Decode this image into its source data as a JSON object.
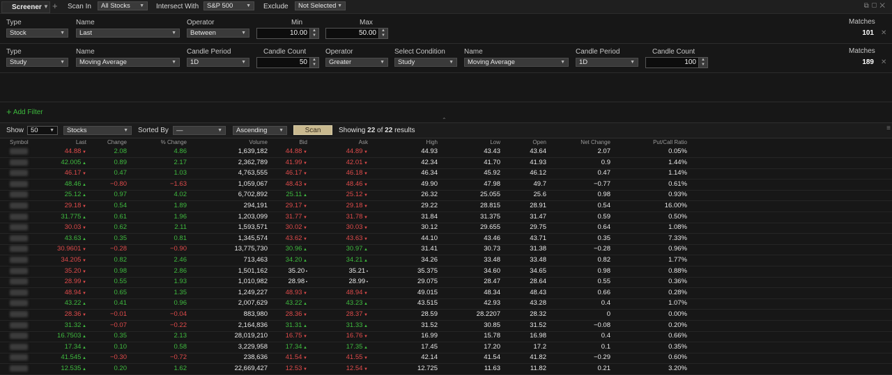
{
  "toolbar": {
    "tab_label": "Screener",
    "scan_in_label": "Scan In",
    "scan_in_value": "All Stocks",
    "intersect_label": "Intersect With",
    "intersect_value": "S&P 500",
    "exclude_label": "Exclude",
    "exclude_value": "Not Selected"
  },
  "filter1": {
    "type_label": "Type",
    "type_value": "Stock",
    "name_label": "Name",
    "name_value": "Last",
    "operator_label": "Operator",
    "operator_value": "Between",
    "min_label": "Min",
    "min_value": "10.00",
    "max_label": "Max",
    "max_value": "50.00",
    "matches_label": "Matches",
    "matches_value": "101"
  },
  "filter2": {
    "type_label": "Type",
    "type_value": "Study",
    "name_label": "Name",
    "name_value": "Moving Average",
    "candle_period_label": "Candle Period",
    "candle_period_value": "1D",
    "candle_count_label": "Candle Count",
    "candle_count_value": "50",
    "operator_label": "Operator",
    "operator_value": "Greater",
    "select_condition_label": "Select Condition",
    "select_condition_value": "Study",
    "name2_label": "Name",
    "name2_value": "Moving Average",
    "candle_period2_label": "Candle Period",
    "candle_period2_value": "1D",
    "candle_count2_label": "Candle Count",
    "candle_count2_value": "100",
    "matches_label": "Matches",
    "matches_value": "189"
  },
  "add_filter_label": "Add Filter",
  "controls": {
    "show_label": "Show",
    "show_value": "50",
    "list_value": "Stocks",
    "sorted_by_label": "Sorted By",
    "sorted_by_value": "—",
    "order_value": "Ascending",
    "scan_label": "Scan",
    "showing_prefix": "Showing",
    "showing_count": "22",
    "showing_of": "of",
    "showing_total": "22",
    "showing_suffix": "results"
  },
  "columns": [
    "Symbol",
    "Last",
    "Change",
    "% Change",
    "Volume",
    "Bid",
    "Ask",
    "High",
    "Low",
    "Open",
    "Net Change",
    "Put/Call Ratio"
  ],
  "rows": [
    {
      "dir": "dn",
      "last": "44.88",
      "change": "2.08",
      "pct": "4.86",
      "volume": "1,639,182",
      "bid": "44.88",
      "bd": "dn",
      "ask": "44.89",
      "ad": "dn",
      "high": "44.93",
      "low": "43.43",
      "open": "43.64",
      "net": "2.07",
      "pc": "0.05%"
    },
    {
      "dir": "up",
      "last": "42.005",
      "change": "0.89",
      "pct": "2.17",
      "volume": "2,362,789",
      "bid": "41.99",
      "bd": "dn",
      "ask": "42.01",
      "ad": "dn",
      "high": "42.34",
      "low": "41.70",
      "open": "41.93",
      "net": "0.9",
      "pc": "1.44%"
    },
    {
      "dir": "dn",
      "last": "46.17",
      "change": "0.47",
      "pct": "1.03",
      "volume": "4,763,555",
      "bid": "46.17",
      "bd": "dn",
      "ask": "46.18",
      "ad": "dn",
      "high": "46.34",
      "low": "45.92",
      "open": "46.12",
      "net": "0.47",
      "pc": "1.14%"
    },
    {
      "dir": "up",
      "last": "48.46",
      "change": "−0.80",
      "pct": "−1.63",
      "volume": "1,059,067",
      "bid": "48.43",
      "bd": "dn",
      "ask": "48.46",
      "ad": "dn",
      "high": "49.90",
      "low": "47.98",
      "open": "49.7",
      "net": "−0.77",
      "pc": "0.61%"
    },
    {
      "dir": "up",
      "last": "25.12",
      "change": "0.97",
      "pct": "4.02",
      "volume": "6,702,892",
      "bid": "25.11",
      "bd": "up",
      "ask": "25.12",
      "ad": "dn",
      "high": "26.32",
      "low": "25.055",
      "open": "25.6",
      "net": "0.98",
      "pc": "0.93%"
    },
    {
      "dir": "dn",
      "last": "29.18",
      "change": "0.54",
      "pct": "1.89",
      "volume": "294,191",
      "bid": "29.17",
      "bd": "dn",
      "ask": "29.18",
      "ad": "dn",
      "high": "29.22",
      "low": "28.815",
      "open": "28.91",
      "net": "0.54",
      "pc": "16.00%"
    },
    {
      "dir": "up",
      "last": "31.775",
      "change": "0.61",
      "pct": "1.96",
      "volume": "1,203,099",
      "bid": "31.77",
      "bd": "dn",
      "ask": "31.78",
      "ad": "dn",
      "high": "31.84",
      "low": "31.375",
      "open": "31.47",
      "net": "0.59",
      "pc": "0.50%"
    },
    {
      "dir": "dn",
      "last": "30.03",
      "change": "0.62",
      "pct": "2.11",
      "volume": "1,593,571",
      "bid": "30.02",
      "bd": "dn",
      "ask": "30.03",
      "ad": "dn",
      "high": "30.12",
      "low": "29.655",
      "open": "29.75",
      "net": "0.64",
      "pc": "1.08%"
    },
    {
      "dir": "up",
      "last": "43.63",
      "change": "0.35",
      "pct": "0.81",
      "volume": "1,345,574",
      "bid": "43.62",
      "bd": "dn",
      "ask": "43.63",
      "ad": "dn",
      "high": "44.10",
      "low": "43.46",
      "open": "43.71",
      "net": "0.35",
      "pc": "7.33%"
    },
    {
      "dir": "dn",
      "last": "30.9601",
      "change": "−0.28",
      "pct": "−0.90",
      "volume": "13,775,730",
      "bid": "30.96",
      "bd": "up",
      "ask": "30.97",
      "ad": "up",
      "high": "31.41",
      "low": "30.73",
      "open": "31.38",
      "net": "−0.28",
      "pc": "0.96%"
    },
    {
      "dir": "dn",
      "last": "34.205",
      "change": "0.82",
      "pct": "2.46",
      "volume": "713,463",
      "bid": "34.20",
      "bd": "up",
      "ask": "34.21",
      "ad": "up",
      "high": "34.26",
      "low": "33.48",
      "open": "33.48",
      "net": "0.82",
      "pc": "1.77%"
    },
    {
      "dir": "dn",
      "last": "35.20",
      "change": "0.98",
      "pct": "2.86",
      "volume": "1,501,162",
      "bid": "35.20",
      "bd": "wh",
      "ask": "35.21",
      "ad": "wh",
      "high": "35.375",
      "low": "34.60",
      "open": "34.65",
      "net": "0.98",
      "pc": "0.88%"
    },
    {
      "dir": "dn",
      "last": "28.99",
      "change": "0.55",
      "pct": "1.93",
      "volume": "1,010,982",
      "bid": "28.98",
      "bd": "wh",
      "ask": "28.99",
      "ad": "wh",
      "high": "29.075",
      "low": "28.47",
      "open": "28.64",
      "net": "0.55",
      "pc": "0.36%"
    },
    {
      "dir": "dn",
      "last": "48.94",
      "change": "0.65",
      "pct": "1.35",
      "volume": "1,249,227",
      "bid": "48.93",
      "bd": "dn",
      "ask": "48.94",
      "ad": "dn",
      "high": "49.015",
      "low": "48.34",
      "open": "48.43",
      "net": "0.66",
      "pc": "0.28%"
    },
    {
      "dir": "up",
      "last": "43.22",
      "change": "0.41",
      "pct": "0.96",
      "volume": "2,007,629",
      "bid": "43.22",
      "bd": "up",
      "ask": "43.23",
      "ad": "up",
      "high": "43.515",
      "low": "42.93",
      "open": "43.28",
      "net": "0.4",
      "pc": "1.07%"
    },
    {
      "dir": "dn",
      "last": "28.36",
      "change": "−0.01",
      "pct": "−0.04",
      "volume": "883,980",
      "bid": "28.36",
      "bd": "dn",
      "ask": "28.37",
      "ad": "dn",
      "high": "28.59",
      "low": "28.2207",
      "open": "28.32",
      "net": "0",
      "pc": "0.00%"
    },
    {
      "dir": "up",
      "last": "31.32",
      "change": "−0.07",
      "pct": "−0.22",
      "volume": "2,164,836",
      "bid": "31.31",
      "bd": "up",
      "ask": "31.33",
      "ad": "up",
      "high": "31.52",
      "low": "30.85",
      "open": "31.52",
      "net": "−0.08",
      "pc": "0.20%"
    },
    {
      "dir": "up",
      "last": "16.7503",
      "change": "0.35",
      "pct": "2.13",
      "volume": "28,019,210",
      "bid": "16.75",
      "bd": "dn",
      "ask": "16.76",
      "ad": "dn",
      "high": "16.99",
      "low": "15.78",
      "open": "16.98",
      "net": "0.4",
      "pc": "0.66%"
    },
    {
      "dir": "up",
      "last": "17.34",
      "change": "0.10",
      "pct": "0.58",
      "volume": "3,229,958",
      "bid": "17.34",
      "bd": "up",
      "ask": "17.35",
      "ad": "up",
      "high": "17.45",
      "low": "17.20",
      "open": "17.2",
      "net": "0.1",
      "pc": "0.35%"
    },
    {
      "dir": "up",
      "last": "41.545",
      "change": "−0.30",
      "pct": "−0.72",
      "volume": "238,636",
      "bid": "41.54",
      "bd": "dn",
      "ask": "41.55",
      "ad": "dn",
      "high": "42.14",
      "low": "41.54",
      "open": "41.82",
      "net": "−0.29",
      "pc": "0.60%"
    },
    {
      "dir": "up",
      "last": "12.535",
      "change": "0.20",
      "pct": "1.62",
      "volume": "22,669,427",
      "bid": "12.53",
      "bd": "dn",
      "ask": "12.54",
      "ad": "dn",
      "high": "12.725",
      "low": "11.63",
      "open": "11.82",
      "net": "0.21",
      "pc": "3.20%"
    }
  ]
}
